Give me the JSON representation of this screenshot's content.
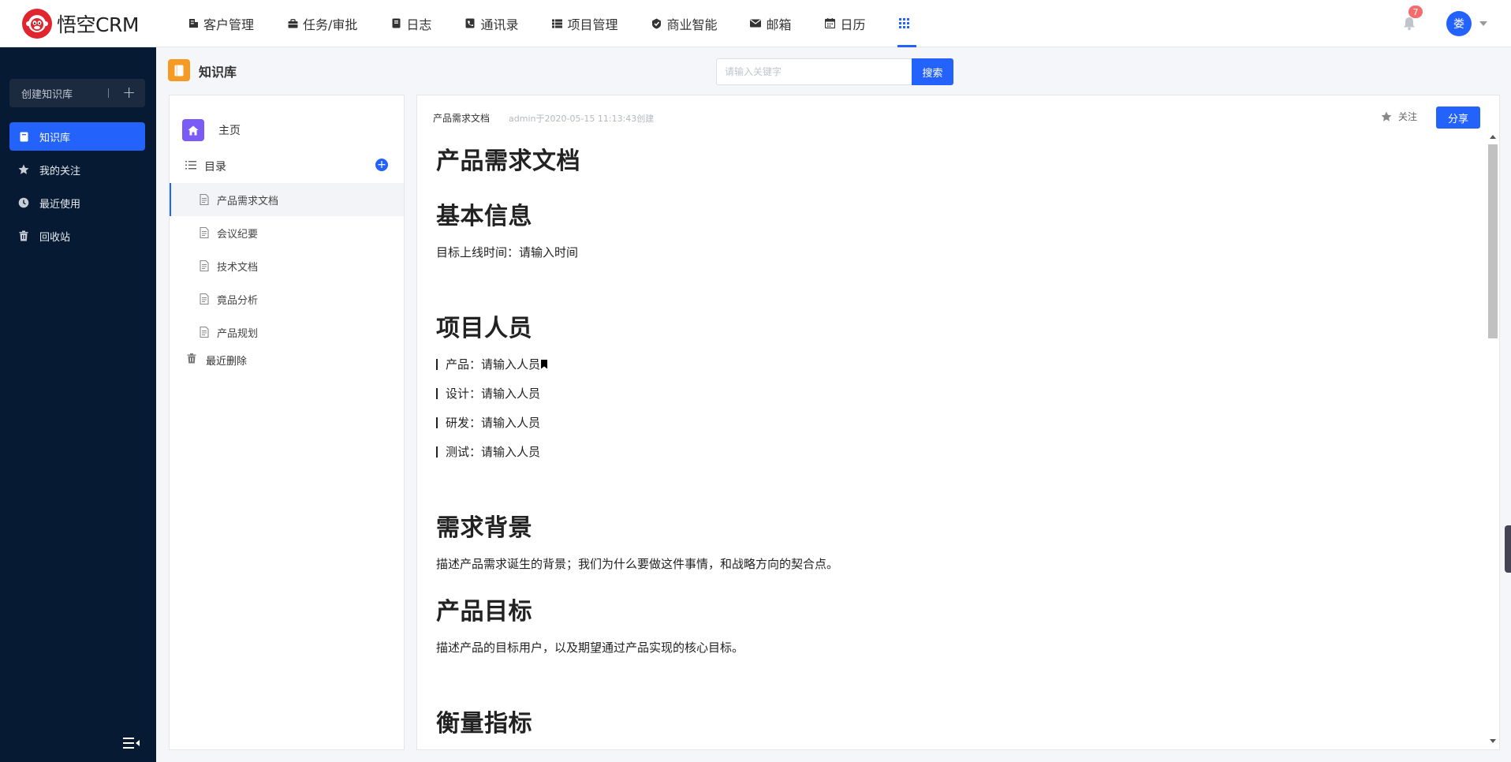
{
  "app": {
    "logo_text": "悟空CRM"
  },
  "nav": {
    "items": [
      {
        "label": "客户管理",
        "icon": "building-icon"
      },
      {
        "label": "任务/审批",
        "icon": "briefcase-icon"
      },
      {
        "label": "日志",
        "icon": "book-icon"
      },
      {
        "label": "通讯录",
        "icon": "contacts-icon"
      },
      {
        "label": "项目管理",
        "icon": "list-icon"
      },
      {
        "label": "商业智能",
        "icon": "shield-check-icon"
      },
      {
        "label": "邮箱",
        "icon": "mail-icon"
      },
      {
        "label": "日历",
        "icon": "calendar-icon"
      }
    ],
    "apps_icon": "grid-icon"
  },
  "header": {
    "notification_count": "7",
    "avatar_text": "娄"
  },
  "sidebar": {
    "create_label": "创建知识库",
    "create_plus": "+",
    "items": [
      {
        "label": "知识库",
        "icon": "book-icon",
        "active": true
      },
      {
        "label": "我的关注",
        "icon": "star-icon",
        "active": false
      },
      {
        "label": "最近使用",
        "icon": "clock-icon",
        "active": false
      },
      {
        "label": "回收站",
        "icon": "trash-icon",
        "active": false
      }
    ]
  },
  "page": {
    "title": "知识库",
    "search_placeholder": "请输入关键字",
    "search_button": "搜索"
  },
  "tree": {
    "home_label": "主页",
    "toc_label": "目录",
    "toc_add": "+",
    "docs": [
      {
        "label": "产品需求文档",
        "active": true
      },
      {
        "label": "会议纪要",
        "active": false
      },
      {
        "label": "技术文档",
        "active": false
      },
      {
        "label": "竟品分析",
        "active": false
      },
      {
        "label": "产品规划",
        "active": false
      }
    ],
    "recent_deleted": "最近删除"
  },
  "doc": {
    "name": "产品需求文档",
    "info": "admin于2020-05-15 11:13:43创建",
    "follow_label": "关注",
    "share_label": "分享",
    "title": "产品需求文档",
    "section_basic": "基本信息",
    "launch_time": "目标上线时间：请输入时间",
    "section_people": "项目人员",
    "people": [
      "产品：请输入人员",
      "设计：请输入人员",
      "研发：请输入人员",
      "测试：请输入人员"
    ],
    "section_background": "需求背景",
    "background_text": "描述产品需求诞生的背景；我们为什么要做这件事情，和战略方向的契合点。",
    "section_goal": "产品目标",
    "goal_text": "描述产品的目标用户，以及期望通过产品实现的核心目标。",
    "section_metrics": "衡量指标"
  },
  "colors": {
    "primary": "#2362fb",
    "sidebar_bg": "#061a33",
    "logo_red": "#e0252f",
    "kb_orange": "#f59a23",
    "home_purple": "#7b5bf5",
    "badge_red": "#f56c6c"
  }
}
